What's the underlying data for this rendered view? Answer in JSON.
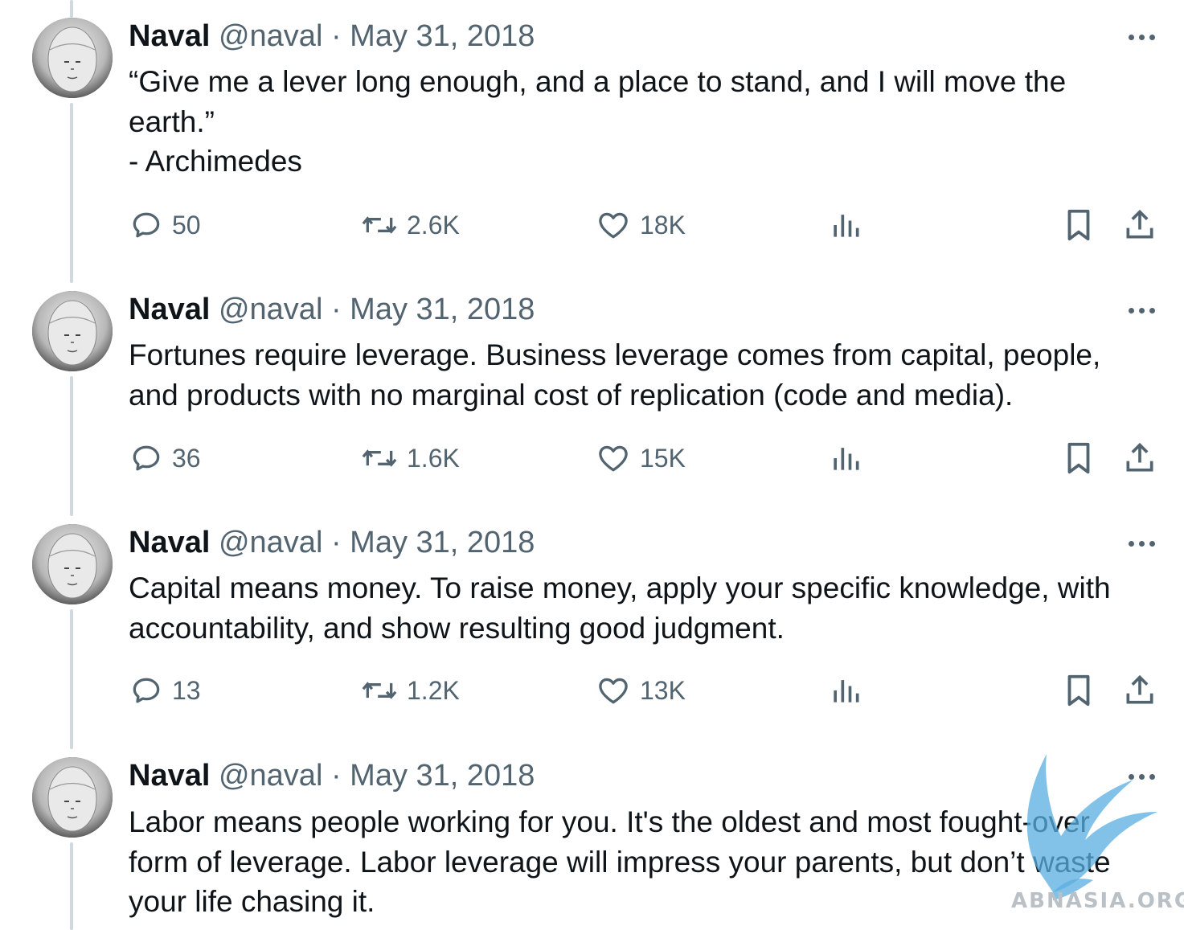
{
  "tweets": [
    {
      "name": "Naval",
      "handle": "@naval",
      "separator": "·",
      "date": "May 31, 2018",
      "text_lines": [
        "“Give me a lever long enough, and a place to stand, and I will move the",
        "earth.”",
        "- Archimedes"
      ],
      "stats": {
        "replies": "50",
        "retweets": "2.6K",
        "likes": "18K"
      }
    },
    {
      "name": "Naval",
      "handle": "@naval",
      "separator": "·",
      "date": "May 31, 2018",
      "text_lines": [
        "Fortunes require leverage. Business leverage comes from capital, people,",
        "and products with no marginal cost of replication (code and media)."
      ],
      "stats": {
        "replies": "36",
        "retweets": "1.6K",
        "likes": "15K"
      }
    },
    {
      "name": "Naval",
      "handle": "@naval",
      "separator": "·",
      "date": "May 31, 2018",
      "text_lines": [
        "Capital means money. To raise money, apply your specific knowledge, with",
        "accountability, and show resulting good judgment."
      ],
      "stats": {
        "replies": "13",
        "retweets": "1.2K",
        "likes": "13K"
      }
    },
    {
      "name": "Naval",
      "handle": "@naval",
      "separator": "·",
      "date": "May 31, 2018",
      "text_lines": [
        "Labor means people working for you. It's the oldest and most fought-over",
        "form of leverage. Labor leverage will impress your parents, but don’t waste",
        "your life chasing it."
      ]
    }
  ],
  "icons": {
    "reply": "speech-bubble-icon",
    "retweet": "retweet-arrows-icon",
    "like": "heart-icon",
    "views": "bar-chart-icon",
    "bookmark": "bookmark-icon",
    "share": "upload-share-icon",
    "more": "ellipsis-icon"
  },
  "watermark": {
    "text": "ABNASIA.ORG"
  },
  "colors": {
    "text": "#0f1419",
    "secondary": "#536471",
    "thread_line": "#cfd9de",
    "watermark_blue": "#5aaee0"
  }
}
